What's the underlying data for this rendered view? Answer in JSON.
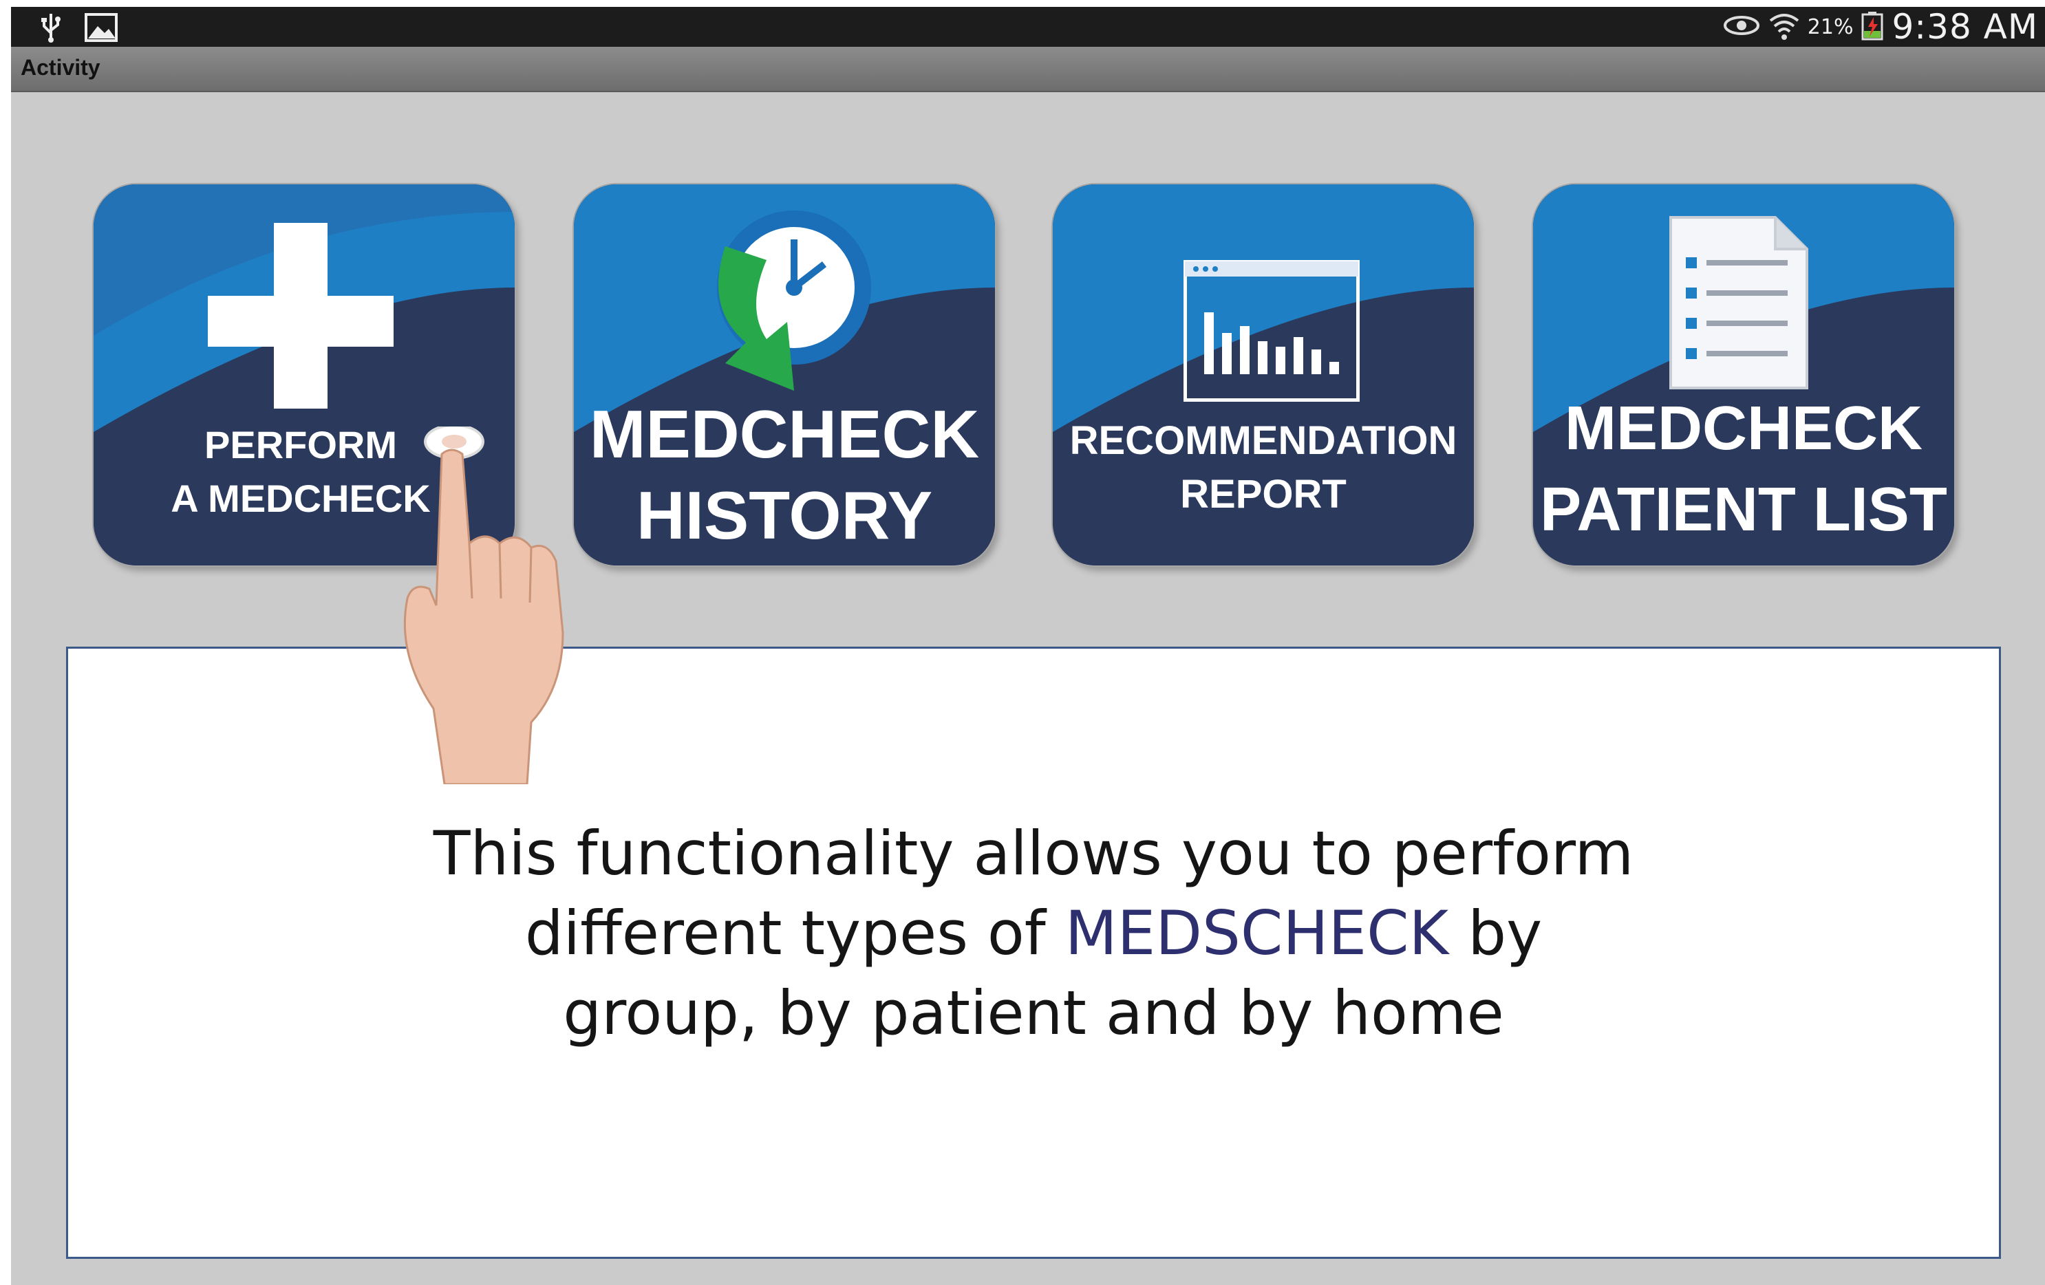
{
  "status_bar": {
    "icons_left": [
      "usb-icon",
      "image-icon"
    ],
    "icons_right": [
      "eye-icon",
      "wifi-icon",
      "battery-charging-icon"
    ],
    "battery_percent": "21%",
    "time": "9:38 AM"
  },
  "action_bar": {
    "title": "Activity"
  },
  "tiles": [
    {
      "line1": "PERFORM",
      "line2": "A MEDCHECK",
      "icon": "plus-icon"
    },
    {
      "line1": "MEDCHECK",
      "line2": "HISTORY",
      "icon": "clock-history-icon"
    },
    {
      "line1": "RECOMMENDATION",
      "line2": "REPORT",
      "icon": "report-chart-icon"
    },
    {
      "line1": "MEDCHECK",
      "line2": "PATIENT LIST",
      "icon": "document-list-icon"
    }
  ],
  "info": {
    "line1": "This functionality allows you to perform",
    "line2_before": "different types of ",
    "line2_highlight": "MEDSCHECK",
    "line2_after": " by",
    "line3": "group, by patient and by home"
  },
  "colors": {
    "tile_dark": "#2b3a5c",
    "tile_blue": "#1f7fc4",
    "highlight_text": "#2e2f6e",
    "panel_border": "#3b5a8a"
  }
}
